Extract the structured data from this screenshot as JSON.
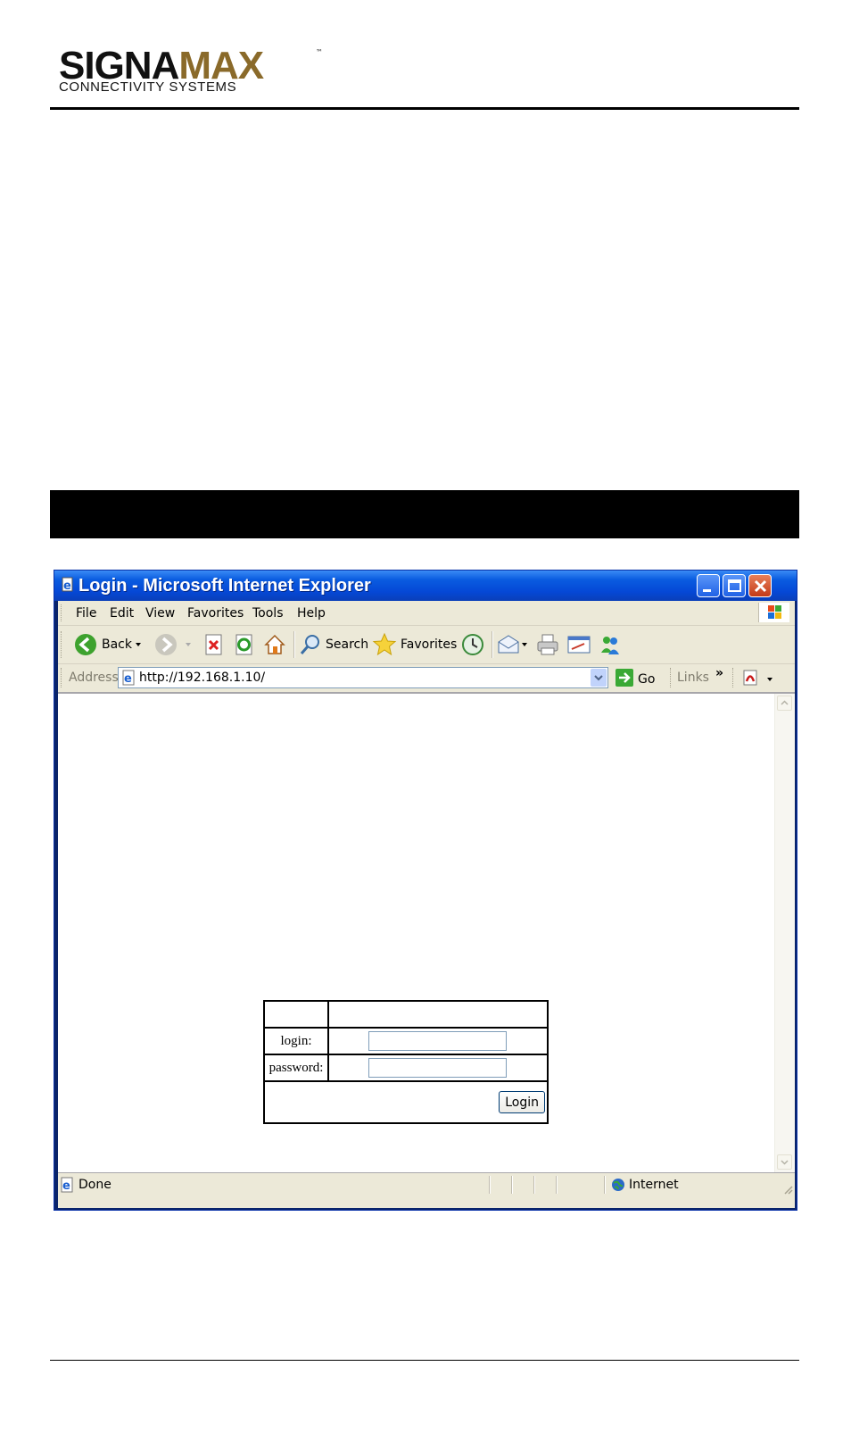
{
  "page": {
    "logo_main": "SIGNA",
    "logo_accent": "MAX",
    "logo_tm": "™",
    "logo_sub": "CONNECTIVITY SYSTEMS"
  },
  "window": {
    "title": "Login - Microsoft Internet Explorer",
    "menu": [
      "File",
      "Edit",
      "View",
      "Favorites",
      "Tools",
      "Help"
    ],
    "toolbar": {
      "back_label": "Back",
      "search_label": "Search",
      "favorites_label": "Favorites"
    },
    "address": {
      "label": "Address",
      "url": "http://192.168.1.10/",
      "go_label": "Go",
      "links_label": "Links",
      "more": "»"
    },
    "status": {
      "text": "Done",
      "zone": "Internet"
    }
  },
  "login_form": {
    "login_label": "login:",
    "password_label": "password:",
    "login_value": "",
    "password_value": "",
    "submit_label": "Login"
  },
  "colors": {
    "titlebar": "#0548d6",
    "chrome": "#ece9d8",
    "logo_accent": "#8a6a2a"
  }
}
